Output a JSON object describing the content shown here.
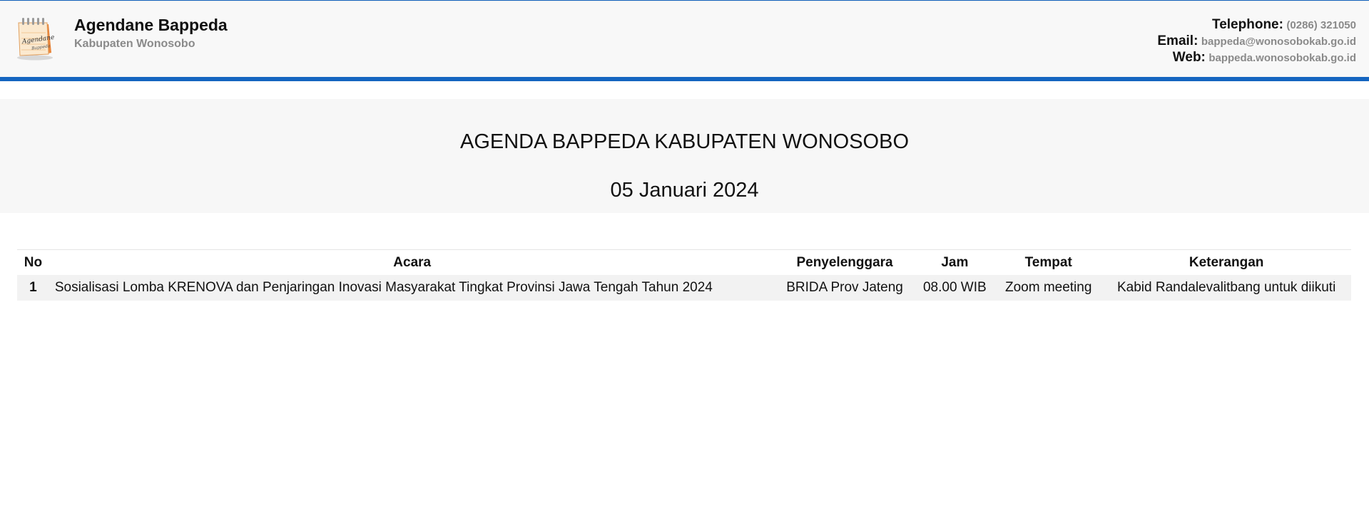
{
  "header": {
    "title": "Agendane Bappeda",
    "subtitle": "Kabupaten Wonosobo",
    "logo_icon": "agenda-notepad-icon",
    "logo_text_line1": "Agendane",
    "logo_text_line2": "Bappeda",
    "contact": {
      "telephone_label": "Telephone:",
      "telephone_value": "(0286) 321050",
      "email_label": "Email:",
      "email_value": "bappeda@wonosobokab.go.id",
      "web_label": "Web:",
      "web_value": "bappeda.wonosobokab.go.id"
    }
  },
  "banner": {
    "title": "AGENDA BAPPEDA KABUPATEN WONOSOBO",
    "date": "05 Januari 2024"
  },
  "table": {
    "headers": {
      "no": "No",
      "acara": "Acara",
      "penyelenggara": "Penyelenggara",
      "jam": "Jam",
      "tempat": "Tempat",
      "keterangan": "Keterangan"
    },
    "rows": [
      {
        "no": "1",
        "acara": "Sosialisasi Lomba KRENOVA dan Penjaringan Inovasi Masyarakat Tingkat Provinsi Jawa Tengah Tahun 2024",
        "penyelenggara": "BRIDA Prov Jateng",
        "jam": "08.00 WIB",
        "tempat": "Zoom meeting",
        "keterangan": "Kabid Randalevalitbang untuk diikuti"
      }
    ]
  },
  "colors": {
    "accent": "#1565c0",
    "header_background": "#f8f8f8",
    "muted_text": "#8a8a8a",
    "row_background": "#f2f2f2"
  }
}
